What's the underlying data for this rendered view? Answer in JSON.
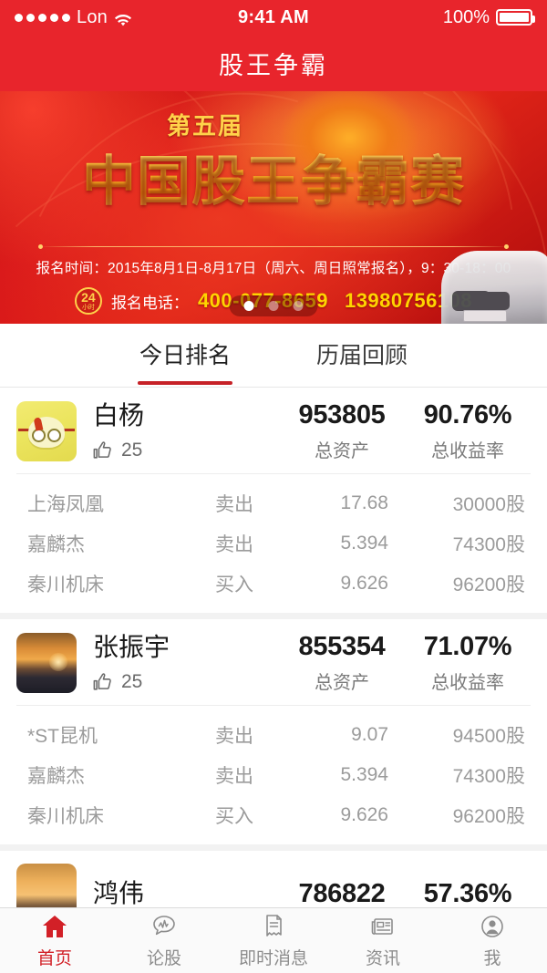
{
  "status_bar": {
    "carrier": "Lon",
    "signal_dots": 5,
    "wifi_icon": "wifi-icon",
    "time": "9:41 AM",
    "battery_percent": "100%",
    "battery_icon": "battery-full-icon"
  },
  "nav": {
    "title": "股王争霸"
  },
  "banner": {
    "edition": "第五届",
    "title": "中国股王争霸赛",
    "registration_time": "报名时间：2015年8月1日-8月17日（周六、周日照常报名），9：30-18：00",
    "badge_number": "24",
    "badge_unit": "小时",
    "phone_label": "报名电话：",
    "phone_1": "400-077-8659",
    "phone_2": "13980756108",
    "dots_total": 3,
    "dots_active_index": 0,
    "car_icon": "car-icon"
  },
  "tabs": [
    {
      "label": "今日排名",
      "active": true
    },
    {
      "label": "历届回顾",
      "active": false
    }
  ],
  "column_labels": {
    "assets": "总资产",
    "return_rate": "总收益率"
  },
  "rankings": [
    {
      "avatar": "cartoon-avatar",
      "name": "白杨",
      "likes_icon": "thumbs-up-icon",
      "likes": "25",
      "total_assets": "953805",
      "assets_label": "总资产",
      "return_rate": "90.76%",
      "return_label": "总收益率",
      "trades": [
        {
          "stock": "上海凤凰",
          "action": "卖出",
          "price": "17.68",
          "qty": "30000股"
        },
        {
          "stock": "嘉麟杰",
          "action": "卖出",
          "price": "5.394",
          "qty": "74300股"
        },
        {
          "stock": "秦川机床",
          "action": "买入",
          "price": "9.626",
          "qty": "96200股"
        }
      ]
    },
    {
      "avatar": "sunset-photo-avatar",
      "name": "张振宇",
      "likes_icon": "thumbs-up-icon",
      "likes": "25",
      "total_assets": "855354",
      "assets_label": "总资产",
      "return_rate": "71.07%",
      "return_label": "总收益率",
      "trades": [
        {
          "stock": "*ST昆机",
          "action": "卖出",
          "price": "9.07",
          "qty": "94500股"
        },
        {
          "stock": "嘉麟杰",
          "action": "卖出",
          "price": "5.394",
          "qty": "74300股"
        },
        {
          "stock": "秦川机床",
          "action": "买入",
          "price": "9.626",
          "qty": "96200股"
        }
      ]
    },
    {
      "avatar": "sunset-photo-avatar",
      "name": "鸿伟",
      "total_assets": "786822",
      "return_rate": "57.36%"
    }
  ],
  "tabbar": [
    {
      "label": "首页",
      "icon": "home-icon",
      "active": true
    },
    {
      "label": "论股",
      "icon": "chat-chart-icon",
      "active": false
    },
    {
      "label": "即时消息",
      "icon": "receipt-icon",
      "active": false
    },
    {
      "label": "资讯",
      "icon": "newspaper-icon",
      "active": false
    },
    {
      "label": "我",
      "icon": "person-icon",
      "active": false
    }
  ],
  "colors": {
    "brand_red": "#e8252c",
    "accent_red": "#c62127",
    "gold": "#ffd400"
  }
}
